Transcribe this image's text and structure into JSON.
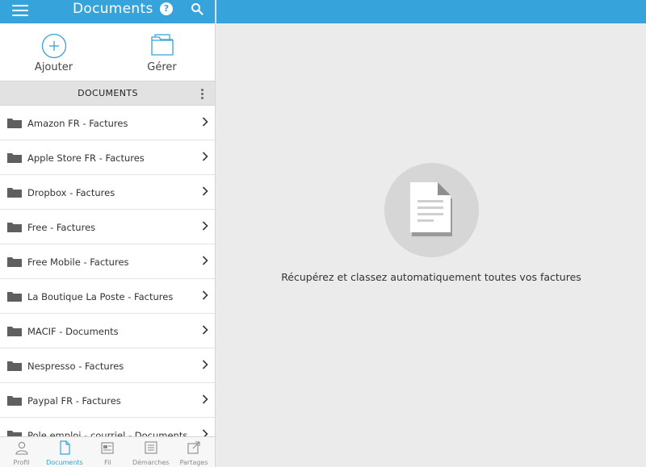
{
  "header": {
    "title": "Documents",
    "help": "?"
  },
  "actions": {
    "add_label": "Ajouter",
    "manage_label": "Gérer"
  },
  "section": {
    "title": "DOCUMENTS"
  },
  "folders": [
    "Amazon FR - Factures",
    "Apple Store FR - Factures",
    "Dropbox - Factures",
    "Free - Factures",
    "Free Mobile - Factures",
    "La Boutique La Poste - Factures",
    "MACIF - Documents",
    "Nespresso - Factures",
    "Paypal FR - Factures",
    "Pole emploi - courriel - Documents"
  ],
  "tabs": [
    {
      "label": "Profil",
      "icon": "person-icon",
      "active": false
    },
    {
      "label": "Documents",
      "icon": "document-icon",
      "active": true
    },
    {
      "label": "Fil",
      "icon": "feed-icon",
      "active": false
    },
    {
      "label": "Démarches",
      "icon": "list-icon",
      "active": false
    },
    {
      "label": "Partages",
      "icon": "share-icon",
      "active": false
    }
  ],
  "empty_state": {
    "message": "Récupérez et classez automatiquement toutes vos factures"
  },
  "colors": {
    "accent": "#36a3da",
    "background": "#ebebeb",
    "folder": "#5f5f5f"
  }
}
